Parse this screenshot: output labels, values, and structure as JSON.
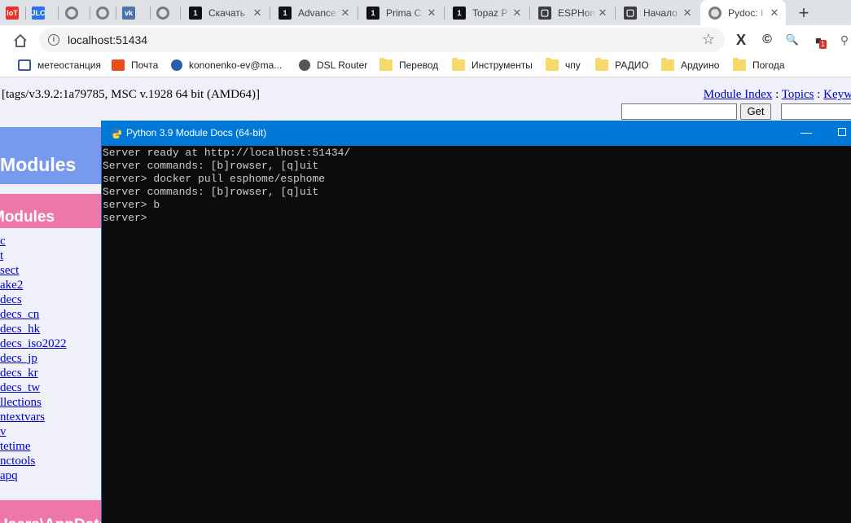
{
  "tabs": [
    {
      "title": "",
      "favicon": "IoT",
      "fav_color": "#e8322c",
      "fav_text": "#ffffff"
    },
    {
      "title": "",
      "favicon": "JLC",
      "fav_color": "#2a73e8",
      "fav_text": "#ffffff"
    },
    {
      "title": "",
      "favicon": "globe",
      "fav_color": "#7a7d80",
      "fav_text": "#ffffff"
    },
    {
      "title": "",
      "favicon": "globe",
      "fav_color": "#7a7d80",
      "fav_text": "#ffffff"
    },
    {
      "title": "",
      "favicon": "vk",
      "fav_color": "#4a76a8",
      "fav_text": "#ffffff"
    },
    {
      "title": "",
      "favicon": "globe",
      "fav_color": "#7a7d80",
      "fav_text": "#ffffff"
    },
    {
      "title": "Скачать",
      "favicon": "1",
      "fav_color": "#111111",
      "fav_text": "#ffffff"
    },
    {
      "title": "Advance",
      "favicon": "1",
      "fav_color": "#111111",
      "fav_text": "#ffffff"
    },
    {
      "title": "Prima C",
      "favicon": "1",
      "fav_color": "#111111",
      "fav_text": "#ffffff"
    },
    {
      "title": "Topaz P",
      "favicon": "1",
      "fav_color": "#111111",
      "fav_text": "#ffffff"
    },
    {
      "title": "ESPHom",
      "favicon": "esphome",
      "fav_color": "#3d3d3d",
      "fav_text": "#ffffff"
    },
    {
      "title": "Начало",
      "favicon": "esphome",
      "fav_color": "#3d3d3d",
      "fav_text": "#ffffff"
    },
    {
      "title": "Pydoc: I",
      "favicon": "globe",
      "fav_color": "#7a7d80",
      "fav_text": "#ffffff",
      "active": true
    }
  ],
  "newtab_label": "+",
  "address": {
    "url": "localhost:51434"
  },
  "extensions": [
    "X",
    "©",
    "🔍",
    "■"
  ],
  "ext_badge": "1",
  "bookmarks": [
    {
      "label": "",
      "icon": "cut-icon"
    },
    {
      "label": "метеостанция",
      "icon": "house-icon"
    },
    {
      "label": "Почта",
      "icon": "mail-icon"
    },
    {
      "label": "kononenko-ev@ma...",
      "icon": "at-icon"
    },
    {
      "label": "DSL Router",
      "icon": "globe-icon"
    },
    {
      "label": "Перевод",
      "icon": "folder-icon"
    },
    {
      "label": "Инструменты",
      "icon": "folder-icon"
    },
    {
      "label": "чпу",
      "icon": "folder-icon"
    },
    {
      "label": "РАДИО",
      "icon": "folder-icon"
    },
    {
      "label": "Ардуино",
      "icon": "folder-icon"
    },
    {
      "label": "Погода",
      "icon": "folder-icon"
    }
  ],
  "page": {
    "version": "[tags/v3.9.2:1a79785, MSC v.1928 64 bit (AMD64)]",
    "links": {
      "module_index": "Module Index",
      "sep1": " : ",
      "topics": "Topics",
      "sep2": " : ",
      "keywords": "Keyw"
    },
    "get_label": "Get",
    "index_banner": "f Modules",
    "modules_banner": "Modules",
    "site_banner": "Users\\AppData",
    "modules": [
      "c",
      "t",
      "sect",
      "ake2",
      "decs",
      "decs_cn",
      "decs_hk",
      "decs_iso2022",
      "decs_jp",
      "decs_kr",
      "decs_tw",
      "llections",
      "ntextvars",
      "v",
      "tetime",
      "nctools",
      "apq"
    ]
  },
  "console": {
    "title": "Python 3.9 Module Docs (64-bit)",
    "min": "—",
    "lines": [
      "Server ready at http://localhost:51434/",
      "Server commands: [b]rowser, [q]uit",
      "server> docker pull esphome/esphome",
      "Server commands: [b]rowser, [q]uit",
      "server> b",
      "server>"
    ]
  }
}
